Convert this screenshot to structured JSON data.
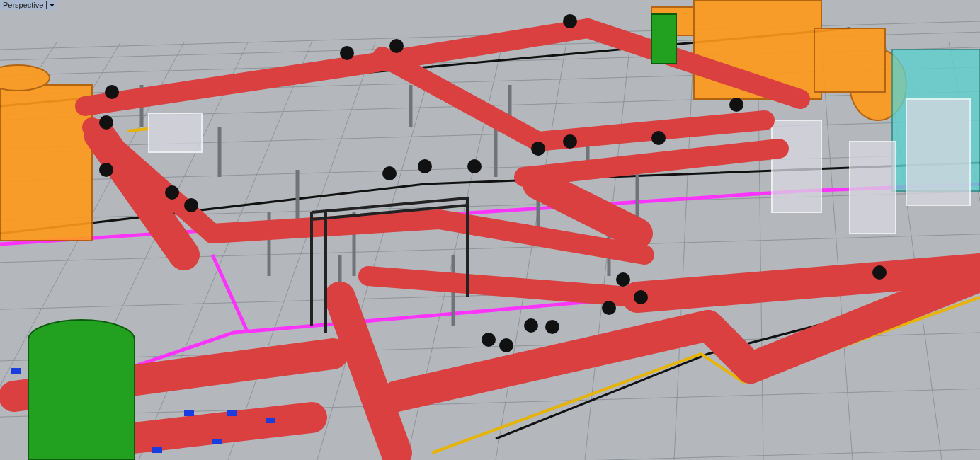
{
  "viewport": {
    "title": "Perspective"
  }
}
